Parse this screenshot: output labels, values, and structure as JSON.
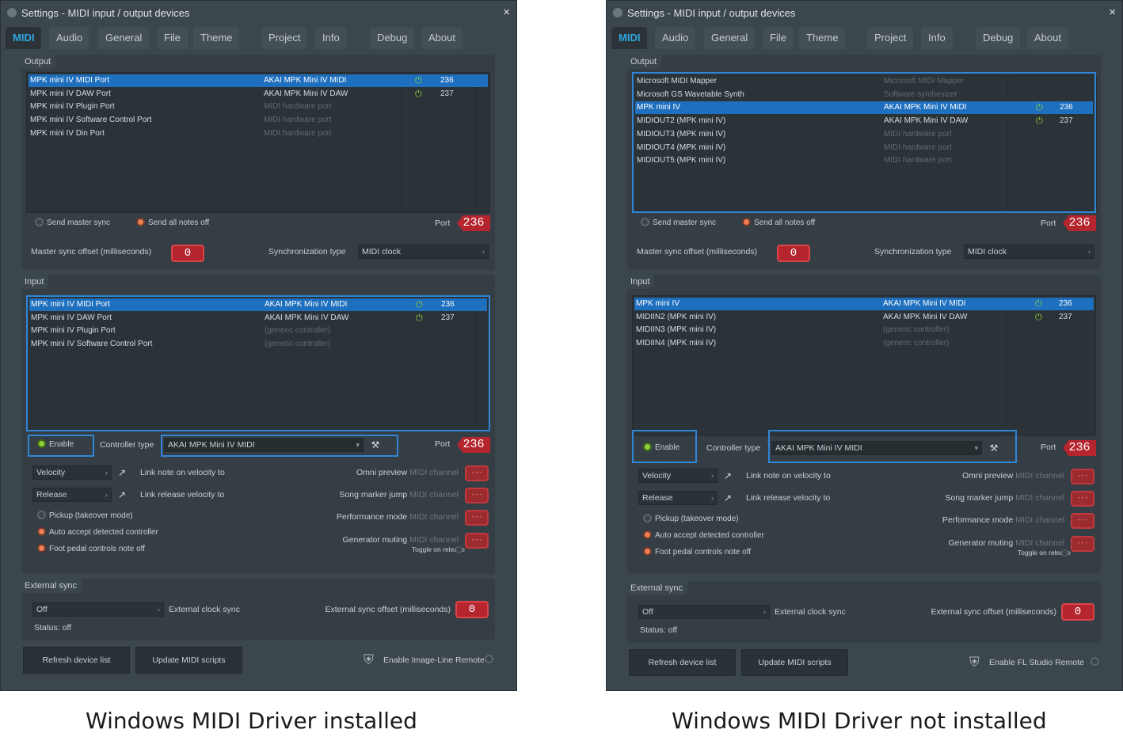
{
  "left": {
    "title": "Settings - MIDI input / output devices",
    "tabs": [
      "MIDI",
      "Audio",
      "General",
      "File",
      "Theme",
      "Project",
      "Info",
      "Debug",
      "About"
    ],
    "output_label": "Output",
    "output_rows": [
      {
        "name": "MPK mini IV MIDI Port",
        "device": "AKAI MPK Mini IV MIDI",
        "port": "236",
        "power": true,
        "selected": true
      },
      {
        "name": "MPK mini IV DAW Port",
        "device": "AKAI MPK Mini IV DAW",
        "port": "237",
        "power": true,
        "selected": false
      },
      {
        "name": "MPK mini IV Plugin Port",
        "device": "MIDI hardware port",
        "port": "",
        "power": false,
        "selected": false
      },
      {
        "name": "MPK mini IV Software Control Port",
        "device": "MIDI hardware port",
        "port": "",
        "power": false,
        "selected": false
      },
      {
        "name": "MPK mini IV Din Port",
        "device": "MIDI hardware port",
        "port": "",
        "power": false,
        "selected": false
      }
    ],
    "send_master_sync": "Send master sync",
    "send_all_notes_off": "Send all notes off",
    "port_label": "Port",
    "output_port": "236",
    "master_sync_label": "Master sync offset (milliseconds)",
    "master_sync_value": "0",
    "sync_type_label": "Synchronization type",
    "sync_type_value": "MIDI clock",
    "input_label": "Input",
    "input_rows": [
      {
        "name": "MPK mini IV MIDI Port",
        "device": "AKAI MPK Mini IV MIDI",
        "port": "236",
        "power": true,
        "selected": true
      },
      {
        "name": "MPK mini IV DAW Port",
        "device": "AKAI MPK Mini IV DAW",
        "port": "237",
        "power": true,
        "selected": false
      },
      {
        "name": "MPK mini IV Plugin Port",
        "device": "(generic controller)",
        "port": "",
        "power": false,
        "selected": false
      },
      {
        "name": "MPK mini IV Software Control Port",
        "device": "(generic controller)",
        "port": "",
        "power": false,
        "selected": false
      }
    ],
    "enable_label": "Enable",
    "controller_type_label": "Controller type",
    "controller_type_value": "AKAI MPK Mini IV MIDI",
    "input_port": "236",
    "velocity": "Velocity",
    "link_note": "Link note on velocity to",
    "release": "Release",
    "link_release": "Link release velocity to",
    "pickup": "Pickup (takeover mode)",
    "auto_accept": "Auto accept detected controller",
    "foot_pedal": "Foot pedal controls note off",
    "omni_preview": "Omni preview",
    "song_marker": "Song marker jump",
    "performance_mode": "Performance mode",
    "generator_muting": "Generator muting",
    "midi_channel": "MIDI channel",
    "channel_value": "---",
    "toggle_on_release": "Toggle on release",
    "external_sync_label": "External sync",
    "ext_value": "Off",
    "ext_clock_sync": "External clock sync",
    "ext_offset_label": "External sync offset (milliseconds)",
    "ext_offset_value": "0",
    "status": "Status: off",
    "refresh": "Refresh device list",
    "update": "Update MIDI scripts",
    "remote": "Enable Image-Line Remote",
    "caption": "Windows MIDI Driver installed"
  },
  "right": {
    "title": "Settings - MIDI input / output devices",
    "tabs": [
      "MIDI",
      "Audio",
      "General",
      "File",
      "Theme",
      "Project",
      "Info",
      "Debug",
      "About"
    ],
    "output_label": "Output",
    "output_rows": [
      {
        "name": "Microsoft MIDI Mapper",
        "device": "Microsoft MIDI Mapper",
        "port": "",
        "power": false,
        "selected": false
      },
      {
        "name": "Microsoft GS Wavetable Synth",
        "device": "Software synthesizer",
        "port": "",
        "power": false,
        "selected": false
      },
      {
        "name": "MPK mini IV",
        "device": "AKAI MPK Mini IV MIDI",
        "port": "236",
        "power": true,
        "selected": true
      },
      {
        "name": "MIDIOUT2 (MPK mini IV)",
        "device": "AKAI MPK Mini IV DAW",
        "port": "237",
        "power": true,
        "selected": false
      },
      {
        "name": "MIDIOUT3 (MPK mini IV)",
        "device": "MIDI hardware port",
        "port": "",
        "power": false,
        "selected": false
      },
      {
        "name": "MIDIOUT4 (MPK mini IV)",
        "device": "MIDI hardware port",
        "port": "",
        "power": false,
        "selected": false
      },
      {
        "name": "MIDIOUT5 (MPK mini IV)",
        "device": "MIDI hardware port",
        "port": "",
        "power": false,
        "selected": false
      }
    ],
    "send_master_sync": "Send master sync",
    "send_all_notes_off": "Send all notes off",
    "port_label": "Port",
    "output_port": "236",
    "master_sync_label": "Master sync offset (milliseconds)",
    "master_sync_value": "0",
    "sync_type_label": "Synchronization type",
    "sync_type_value": "MIDI clock",
    "input_label": "Input",
    "input_rows": [
      {
        "name": "MPK mini IV",
        "device": "AKAI MPK Mini IV MIDI",
        "port": "236",
        "power": true,
        "selected": true
      },
      {
        "name": "MIDIIN2 (MPK mini IV)",
        "device": "AKAI MPK Mini IV DAW",
        "port": "237",
        "power": true,
        "selected": false
      },
      {
        "name": "MIDIIN3 (MPK mini IV)",
        "device": "(generic controller)",
        "port": "",
        "power": false,
        "selected": false
      },
      {
        "name": "MIDIIN4 (MPK mini IV)",
        "device": "(generic controller)",
        "port": "",
        "power": false,
        "selected": false
      }
    ],
    "enable_label": "Enable",
    "controller_type_label": "Controller type",
    "controller_type_value": "AKAI MPK Mini IV MIDI",
    "input_port": "236",
    "velocity": "Velocity",
    "link_note": "Link note on velocity to",
    "release": "Release",
    "link_release": "Link release velocity to",
    "pickup": "Pickup (takeover mode)",
    "auto_accept": "Auto accept detected controller",
    "foot_pedal": "Foot pedal controls note off",
    "omni_preview": "Omni preview",
    "song_marker": "Song marker jump",
    "performance_mode": "Performance mode",
    "generator_muting": "Generator muting",
    "midi_channel": "MIDI channel",
    "channel_value": "---",
    "toggle_on_release": "Toggle on release",
    "external_sync_label": "External sync",
    "ext_value": "Off",
    "ext_clock_sync": "External clock sync",
    "ext_offset_label": "External sync offset (milliseconds)",
    "ext_offset_value": "0",
    "status": "Status: off",
    "refresh": "Refresh device list",
    "update": "Update MIDI scripts",
    "remote": "Enable FL Studio Remote",
    "caption": "Windows MIDI Driver not installed"
  },
  "icons": {
    "close": "close-icon",
    "power": "power-icon",
    "wrench": "wrench-icon",
    "link": "link-icon",
    "shield": "shield-icon"
  },
  "colors": {
    "accent": "#2f86d6",
    "selection": "#1e6fbe",
    "active_tab": "#2fa8e0",
    "value_red": "#b5252e",
    "power_green": "#8fcf3f",
    "radio_orange": "#f27e52"
  }
}
